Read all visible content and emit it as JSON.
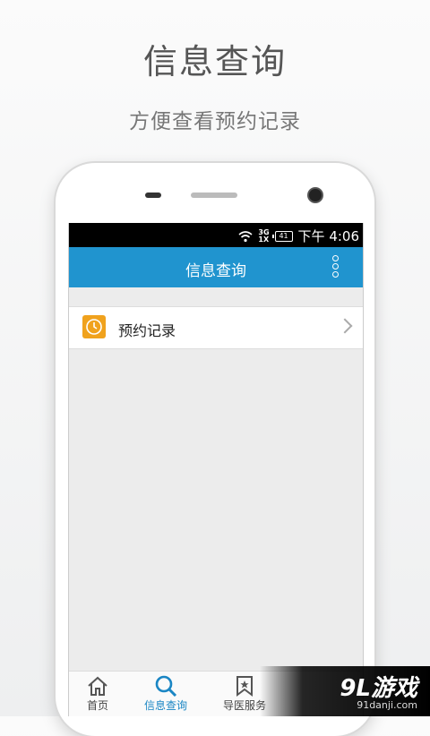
{
  "hero": {
    "title": "信息查询",
    "subtitle": "方便查看预约记录"
  },
  "statusbar": {
    "network": "3G",
    "network2": "1X",
    "battery": "41",
    "time": "下午 4:06"
  },
  "appbar": {
    "title": "信息查询",
    "menu_icon": "overflow-menu-icon"
  },
  "list": [
    {
      "label": "预约记录",
      "icon": "clock-icon"
    }
  ],
  "tabs": [
    {
      "label": "首页",
      "icon": "home-icon",
      "active": false
    },
    {
      "label": "信息查询",
      "icon": "search-icon",
      "active": true
    },
    {
      "label": "导医服务",
      "icon": "bookmark-star-icon",
      "active": false
    }
  ],
  "watermark": {
    "logo": "9L游戏",
    "url": "91danji.com"
  },
  "colors": {
    "accent": "#2094cf",
    "icon_orange": "#f0a21d",
    "active_tab": "#1a86c4"
  }
}
